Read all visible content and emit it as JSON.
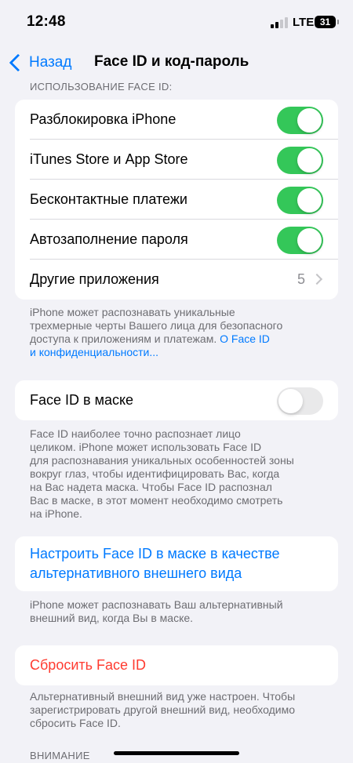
{
  "status_bar": {
    "time": "12:48",
    "network": "LTE",
    "battery": "31"
  },
  "nav": {
    "back_label": "Назад",
    "title": "Face ID и код-пароль"
  },
  "face_id_usage": {
    "header": "ИСПОЛЬЗОВАНИЕ FACE ID:",
    "rows": [
      {
        "label": "Разблокировка iPhone",
        "enabled": true
      },
      {
        "label": "iTunes Store и App Store",
        "enabled": true
      },
      {
        "label": "Бесконтактные платежи",
        "enabled": true
      },
      {
        "label": "Автозаполнение пароля",
        "enabled": true
      }
    ],
    "other_apps": {
      "label": "Другие приложения",
      "count": "5"
    },
    "footer_lines": [
      "iPhone может распознавать уникальные",
      "трехмерные черты Вашего лица для безопасного",
      "доступа к приложениям и платежам."
    ],
    "footer_link_part1": "О Face ID",
    "footer_link_part2": "и конфиденциальности..."
  },
  "mask": {
    "label": "Face ID в маске",
    "enabled": false,
    "footer_lines": [
      "Face ID наиболее точно распознает лицо",
      "целиком. iPhone может использовать Face ID",
      "для распознавания уникальных особенностей зоны",
      "вокруг глаз, чтобы идентифицировать Вас, когда",
      "на Вас надета маска. Чтобы Face ID распознал",
      "Вас в маске, в этот момент необходимо смотреть",
      "на iPhone."
    ]
  },
  "alt_appearance": {
    "label_lines": [
      "Настроить Face ID в маске в качестве",
      "альтернативного внешнего вида"
    ],
    "footer_lines": [
      "iPhone может распознавать Ваш альтернативный",
      "внешний вид, когда Вы в маске."
    ]
  },
  "reset": {
    "label": "Сбросить Face ID",
    "footer_lines": [
      "Альтернативный внешний вид уже настроен. Чтобы",
      "зарегистрировать другой внешний вид, необходимо",
      "сбросить Face ID."
    ]
  },
  "attention_header": "ВНИМАНИЕ",
  "colors": {
    "accent": "#007aff",
    "toggle_on": "#34c759",
    "destructive": "#ff3b30"
  }
}
